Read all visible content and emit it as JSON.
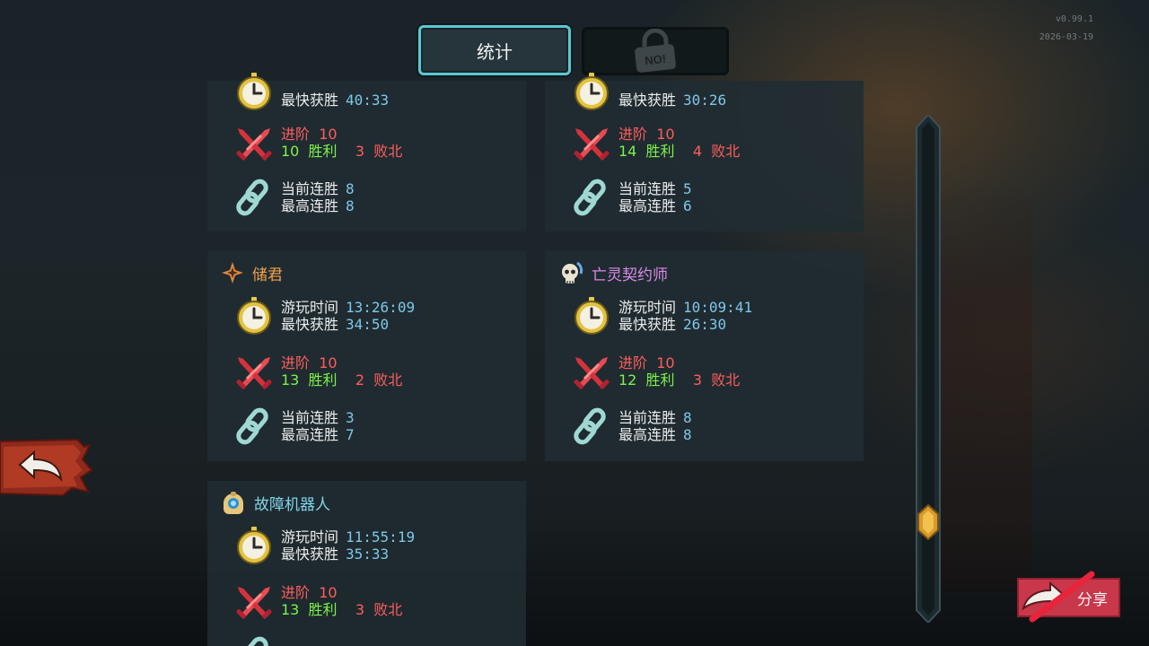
{
  "tabs": {
    "stats_label": "统计",
    "locked_label": "NO!"
  },
  "version": {
    "number": "v0.99.1",
    "date": "2026-03-19"
  },
  "labels": {
    "playtime": "游玩时间",
    "fastest_win": "最快获胜",
    "ascension": "进阶",
    "wins": "胜利",
    "losses": "败北",
    "current_streak": "当前连胜",
    "best_streak": "最高连胜"
  },
  "characters": [
    {
      "name": "",
      "fastest_win": "40:33",
      "ascension": "10",
      "wins": "10",
      "losses": "3",
      "current_streak": "8",
      "best_streak": "8"
    },
    {
      "name": "",
      "fastest_win": "30:26",
      "ascension": "10",
      "wins": "14",
      "losses": "4",
      "current_streak": "5",
      "best_streak": "6"
    },
    {
      "name": "储君",
      "name_color": "#f0a24a",
      "icon": "crown-star-icon",
      "playtime": "13:26:09",
      "fastest_win": "34:50",
      "ascension": "10",
      "wins": "13",
      "losses": "2",
      "current_streak": "3",
      "best_streak": "7"
    },
    {
      "name": "亡灵契约师",
      "name_color": "#d98ae8",
      "icon": "skull-icon",
      "playtime": "10:09:41",
      "fastest_win": "26:30",
      "ascension": "10",
      "wins": "12",
      "losses": "3",
      "current_streak": "8",
      "best_streak": "8"
    },
    {
      "name": "故障机器人",
      "name_color": "#7fd4e8",
      "icon": "robot-orb-icon",
      "playtime": "11:55:19",
      "fastest_win": "35:33",
      "ascension": "10",
      "wins": "13",
      "losses": "3"
    }
  ],
  "share": {
    "label": "分享"
  },
  "colors": {
    "accent_teal": "#5ec6cf",
    "value_blue": "#7fc7e8",
    "loss_red": "#ff5d5d",
    "win_green": "#7cf24a",
    "share_bg": "#c8374a"
  }
}
